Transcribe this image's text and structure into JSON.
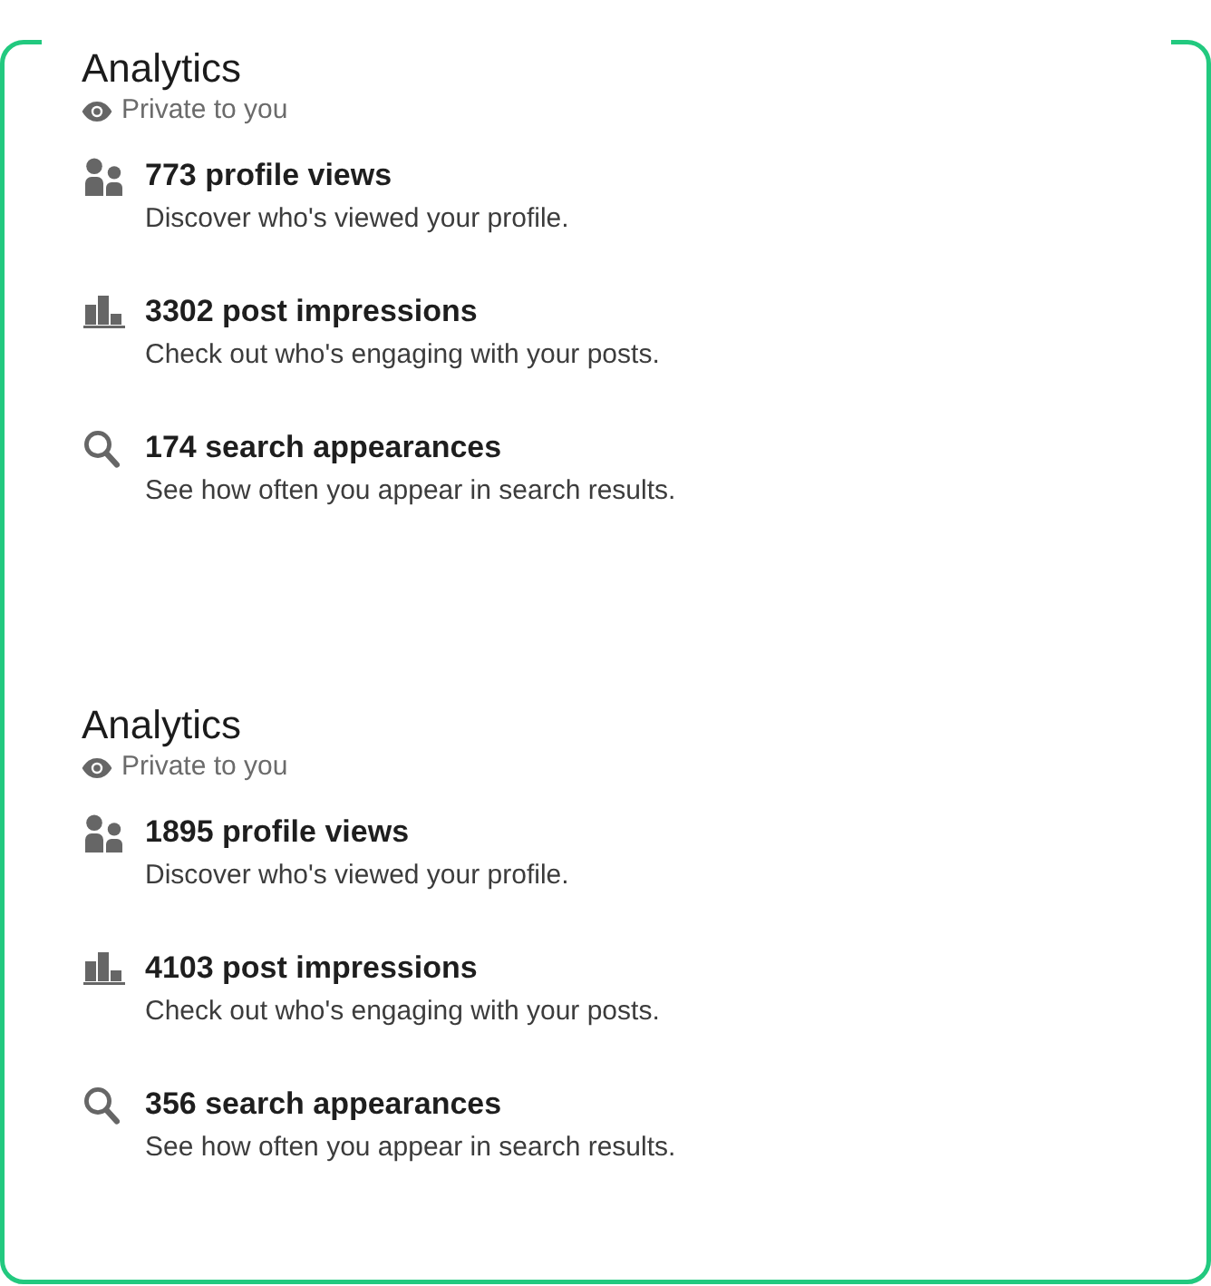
{
  "sections": [
    {
      "title": "Analytics",
      "visibility": "Private to you",
      "stats": [
        {
          "kind": "views",
          "title": "773 profile views",
          "description": "Discover who's viewed your profile."
        },
        {
          "kind": "impressions",
          "title": "3302 post impressions",
          "description": "Check out who's engaging with your posts."
        },
        {
          "kind": "appearances",
          "title": "174 search appearances",
          "description": "See how often you appear in search results."
        }
      ]
    },
    {
      "title": "Analytics",
      "visibility": "Private to you",
      "stats": [
        {
          "kind": "views",
          "title": "1895 profile views",
          "description": "Discover who's viewed your profile."
        },
        {
          "kind": "impressions",
          "title": "4103 post impressions",
          "description": "Check out who's engaging with your posts."
        },
        {
          "kind": "appearances",
          "title": "356 search appearances",
          "description": "See how often you appear in search results."
        }
      ]
    }
  ]
}
